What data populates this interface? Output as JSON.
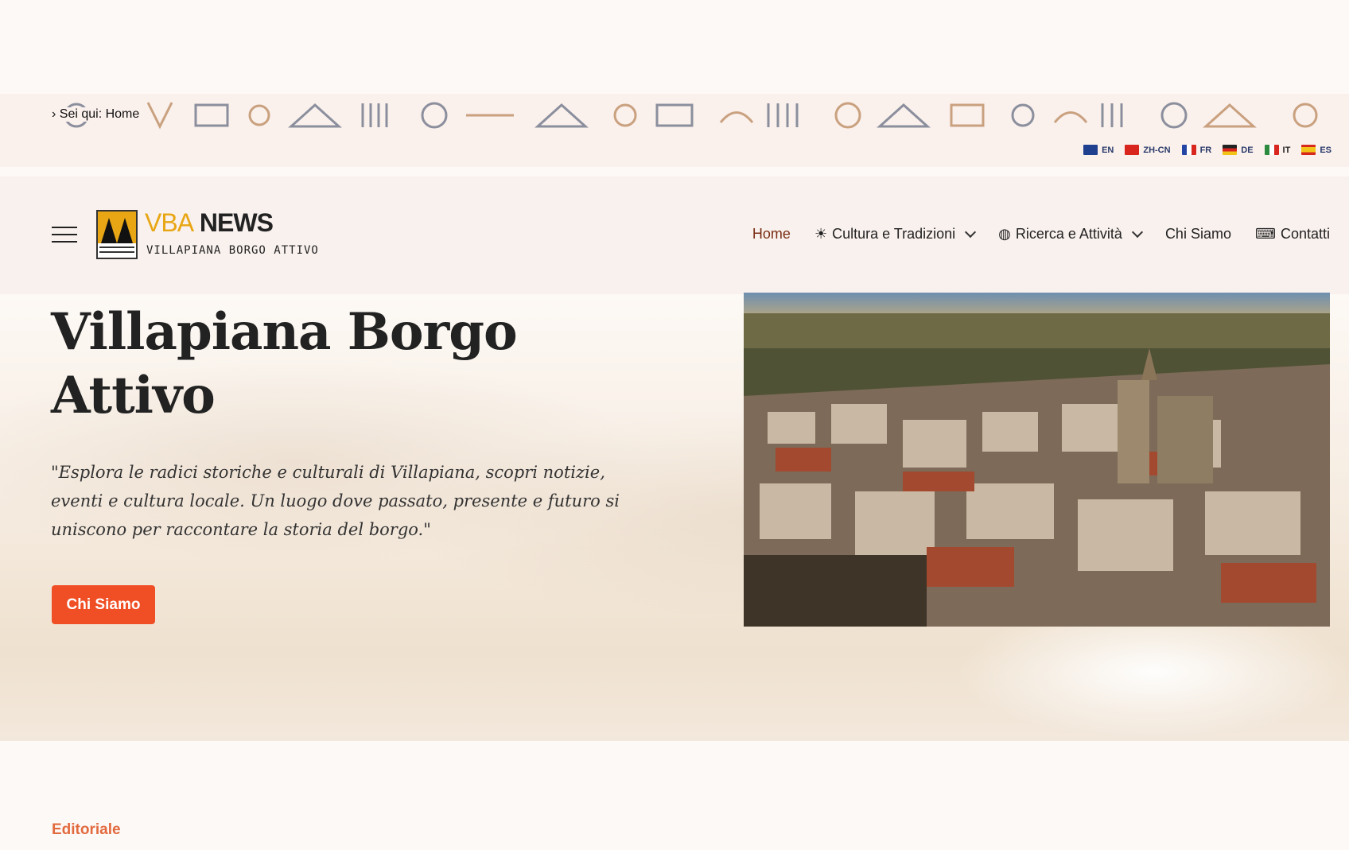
{
  "breadcrumb": {
    "text": "› Sei qui: Home"
  },
  "languages": [
    {
      "code": "EN",
      "color": "#1f3f8f"
    },
    {
      "code": "ZH-CN",
      "color": "#d8261f"
    },
    {
      "code": "FR",
      "color": "#2345a3"
    },
    {
      "code": "DE",
      "color": "#222222"
    },
    {
      "code": "IT",
      "color": "#2c8a3e"
    },
    {
      "code": "ES",
      "color": "#d6281c"
    }
  ],
  "logo": {
    "title_part1": "VBA",
    "title_part2": "NEWS",
    "subtitle": "VILLAPIANA BORGO ATTIVO"
  },
  "nav": {
    "home": "Home",
    "cultura": "Cultura e Tradizioni",
    "ricerca": "Ricerca e Attività",
    "chi_siamo": "Chi Siamo",
    "contatti": "Contatti"
  },
  "hero": {
    "title": "Villapiana Borgo Attivo",
    "text": "\"Esplora le radici storiche e culturali di Villapiana, scopri notizie, eventi e cultura locale. Un luogo dove passato, presente e futuro si uniscono per raccontare la storia del borgo.\"",
    "button": "Chi Siamo"
  },
  "section": {
    "label": "Editoriale"
  },
  "colors": {
    "accent": "#f04e24",
    "logo_gold": "#e8a614",
    "label": "#e26a3f"
  }
}
